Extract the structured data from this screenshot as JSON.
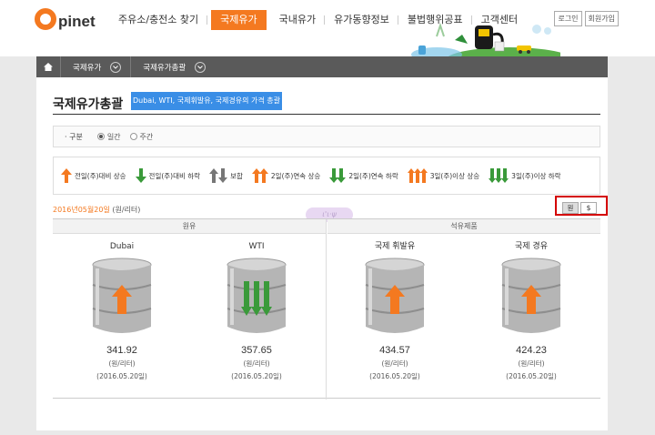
{
  "header": {
    "logo_o": "O",
    "logo_text": "pinet",
    "nav": [
      "주유소/충전소 찾기",
      "국제유가",
      "국내유가",
      "유가동향정보",
      "불법행위공표",
      "고객센터"
    ],
    "nav_active": 1,
    "util": [
      "로그인",
      "회원가입"
    ]
  },
  "breadcrumb": {
    "level1": "국제유가",
    "level2": "국제유가총괄"
  },
  "page": {
    "title": "국제유가총괄",
    "subtitle": "Dubai, WTI, 국제휘발유, 국제경유의 가격 총괄"
  },
  "options": {
    "label": "· 구분",
    "daily": "일간",
    "weekly": "주간",
    "selected": "daily"
  },
  "legend": [
    {
      "label": "전일(주)대비 상승",
      "icon": "arrow-up-orange"
    },
    {
      "label": "전일(주)대비 하락",
      "icon": "arrow-down-green"
    },
    {
      "label": "보합",
      "icon": "flat-gray"
    },
    {
      "label": "2일(주)연속 상승",
      "icon": "double-up-orange"
    },
    {
      "label": "2일(주)연속 하락",
      "icon": "double-down-green"
    },
    {
      "label": "3일(주)이상 상승",
      "icon": "triple-up-orange"
    },
    {
      "label": "3일(주)이상 하락",
      "icon": "triple-down-green"
    }
  ],
  "date_row": {
    "date": "2016년05월20일",
    "unit": "(원/리터)",
    "currency_krw": "원",
    "currency_usd": "$",
    "selected_currency": "krw"
  },
  "groups": {
    "crude": "원유",
    "product": "석유제품"
  },
  "prices": [
    {
      "name": "Dubai",
      "value": "341.92",
      "unit": "(원/리터)",
      "date": "(2016.05.20일)",
      "trend": "up"
    },
    {
      "name": "WTI",
      "value": "357.65",
      "unit": "(원/리터)",
      "date": "(2016.05.20일)",
      "trend": "triple-down"
    },
    {
      "name": "국제 휘발유",
      "value": "434.57",
      "unit": "(원/리터)",
      "date": "(2016.05.20일)",
      "trend": "up"
    },
    {
      "name": "국제 경유",
      "value": "424.23",
      "unit": "(원/리터)",
      "date": "(2016.05.20일)",
      "trend": "up"
    }
  ],
  "colors": {
    "accent": "#f47920",
    "up": "#f47920",
    "down": "#3a9a3a",
    "highlight": "#d40000",
    "subtitle_bg": "#3a8ee6"
  }
}
